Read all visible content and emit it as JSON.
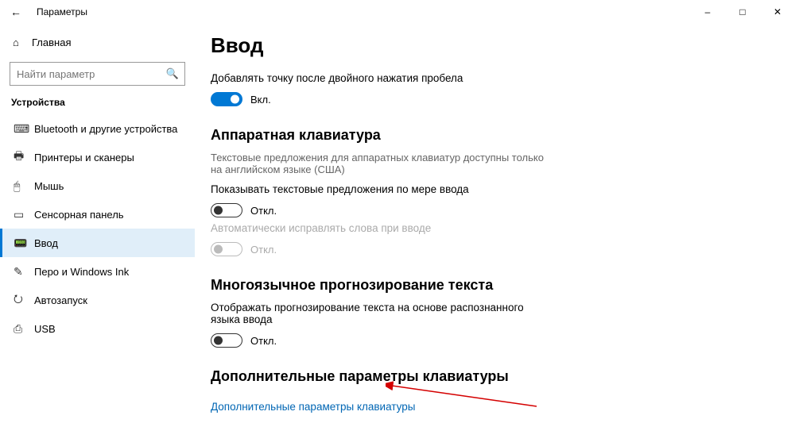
{
  "window": {
    "title": "Параметры"
  },
  "sidebar": {
    "home": "Главная",
    "search_placeholder": "Найти параметр",
    "group": "Устройства",
    "items": [
      {
        "label": "Bluetooth и другие устройства",
        "icon": "⌨"
      },
      {
        "label": "Принтеры и сканеры",
        "icon": "🖶"
      },
      {
        "label": "Мышь",
        "icon": "🖱"
      },
      {
        "label": "Сенсорная панель",
        "icon": "▭"
      },
      {
        "label": "Ввод",
        "icon": "📟",
        "selected": true
      },
      {
        "label": "Перо и Windows Ink",
        "icon": "✎"
      },
      {
        "label": "Автозапуск",
        "icon": "⭮"
      },
      {
        "label": "USB",
        "icon": "⎙"
      }
    ]
  },
  "page": {
    "title": "Ввод",
    "opt1": {
      "label": "Добавлять точку после двойного нажатия пробела",
      "state": "Вкл."
    },
    "sec_hw": {
      "title": "Аппаратная клавиатура",
      "desc": "Текстовые предложения для аппаратных клавиатур доступны только на английском языке (США)",
      "opt2_label": "Показывать текстовые предложения по мере ввода",
      "opt2_state": "Откл.",
      "opt3_label": "Автоматически исправлять слова при вводе",
      "opt3_state": "Откл."
    },
    "sec_multi": {
      "title": "Многоязычное прогнозирование текста",
      "opt4_label": "Отображать прогнозирование текста на основе распознанного языка ввода",
      "opt4_state": "Откл."
    },
    "sec_adv": {
      "title": "Дополнительные параметры клавиатуры",
      "link": "Дополнительные параметры клавиатуры"
    }
  }
}
